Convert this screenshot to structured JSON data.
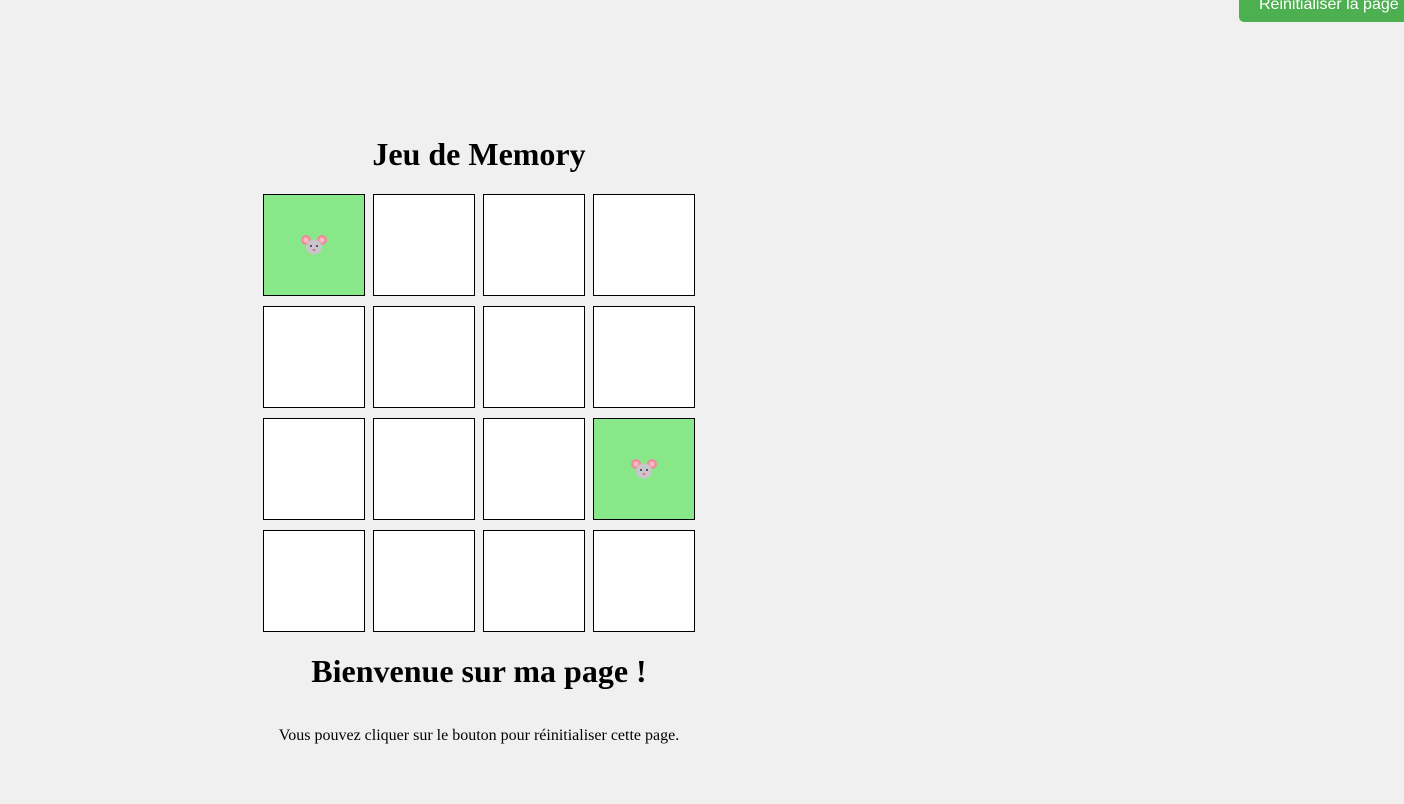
{
  "reset_button": {
    "label": "Réinitialiser la page"
  },
  "game": {
    "title": "Jeu de Memory",
    "revealed_color": "#88e788",
    "hidden_color": "#ffffff",
    "cards": [
      {
        "state": "revealed",
        "icon": "mouse-icon"
      },
      {
        "state": "hidden",
        "icon": ""
      },
      {
        "state": "hidden",
        "icon": ""
      },
      {
        "state": "hidden",
        "icon": ""
      },
      {
        "state": "hidden",
        "icon": ""
      },
      {
        "state": "hidden",
        "icon": ""
      },
      {
        "state": "hidden",
        "icon": ""
      },
      {
        "state": "hidden",
        "icon": ""
      },
      {
        "state": "hidden",
        "icon": ""
      },
      {
        "state": "hidden",
        "icon": ""
      },
      {
        "state": "hidden",
        "icon": ""
      },
      {
        "state": "revealed",
        "icon": "mouse-icon"
      },
      {
        "state": "hidden",
        "icon": ""
      },
      {
        "state": "hidden",
        "icon": ""
      },
      {
        "state": "hidden",
        "icon": ""
      },
      {
        "state": "hidden",
        "icon": ""
      }
    ]
  },
  "welcome": {
    "heading": "Bienvenue sur ma page !",
    "text": "Vous pouvez cliquer sur le bouton pour réinitialiser cette page."
  },
  "accent_color": "#4caf50"
}
